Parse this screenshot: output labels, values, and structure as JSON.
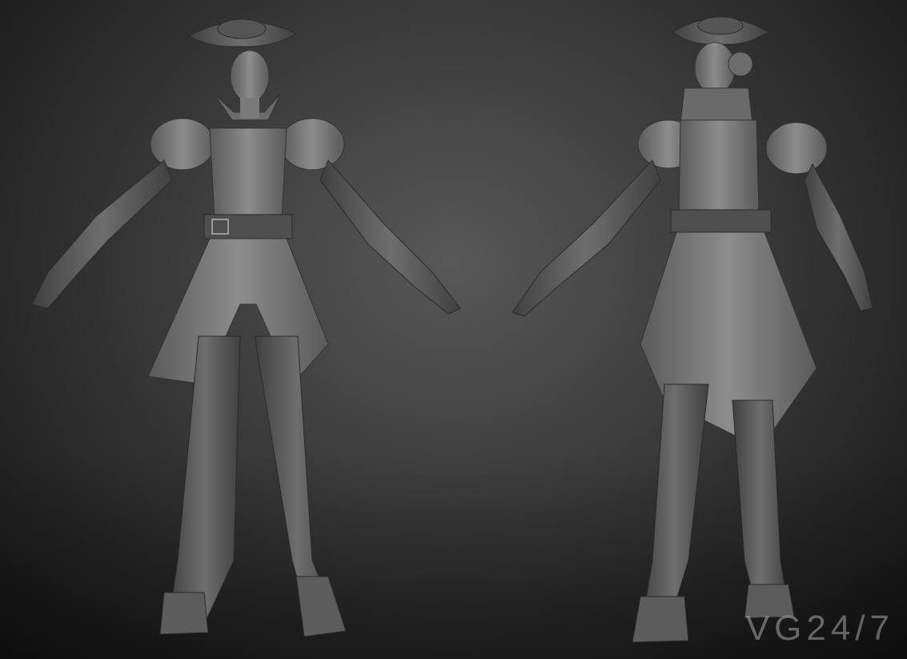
{
  "scene": {
    "description_hint": "",
    "watermark_text": "VG24/7"
  },
  "colors": {
    "sculpt_light": "#8a8a8a",
    "sculpt_mid": "#6b6b6b",
    "sculpt_dark": "#3e3e3e",
    "background_center": "#585858",
    "background_edge": "#141414"
  },
  "icons": {
    "watermark_logo": "vg247-logo"
  }
}
